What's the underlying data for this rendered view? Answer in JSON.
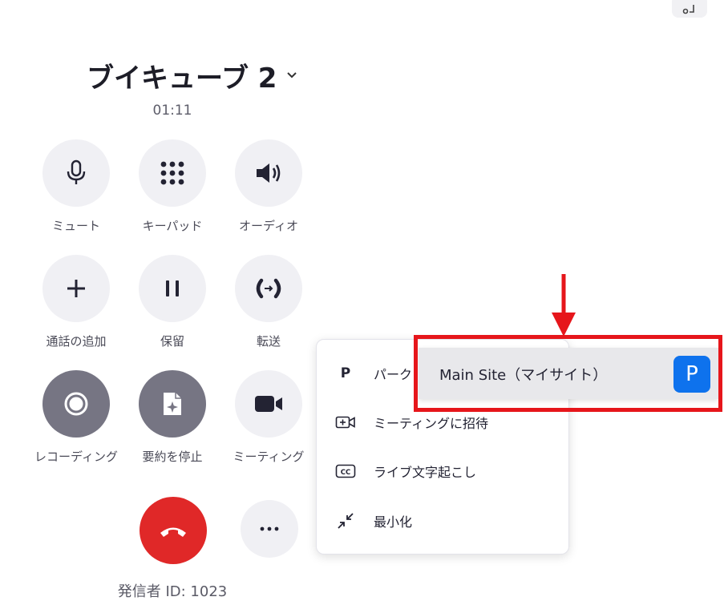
{
  "caller": {
    "name": "ブイキューブ 2",
    "duration": "01:11"
  },
  "controls": {
    "mute": "ミュート",
    "keypad": "キーパッド",
    "audio": "オーディオ",
    "add_call": "通話の追加",
    "hold": "保留",
    "transfer": "転送",
    "recording": "レコーディング",
    "stop_summary": "要約を停止",
    "meeting": "ミーティング",
    "more": "..."
  },
  "caller_id": "発信者 ID: 1023",
  "more_menu": {
    "park": "パーク",
    "park_icon_letter": "P",
    "invite_meeting": "ミーティングに招待",
    "live_transcript": "ライブ文字起こし",
    "minimize": "最小化"
  },
  "park_submenu": {
    "site": "Main Site（マイサイト）",
    "badge": "P"
  },
  "colors": {
    "end_call": "#e02828",
    "badge": "#0e72ed",
    "highlight": "#e6161b",
    "active_control": "#767583"
  }
}
